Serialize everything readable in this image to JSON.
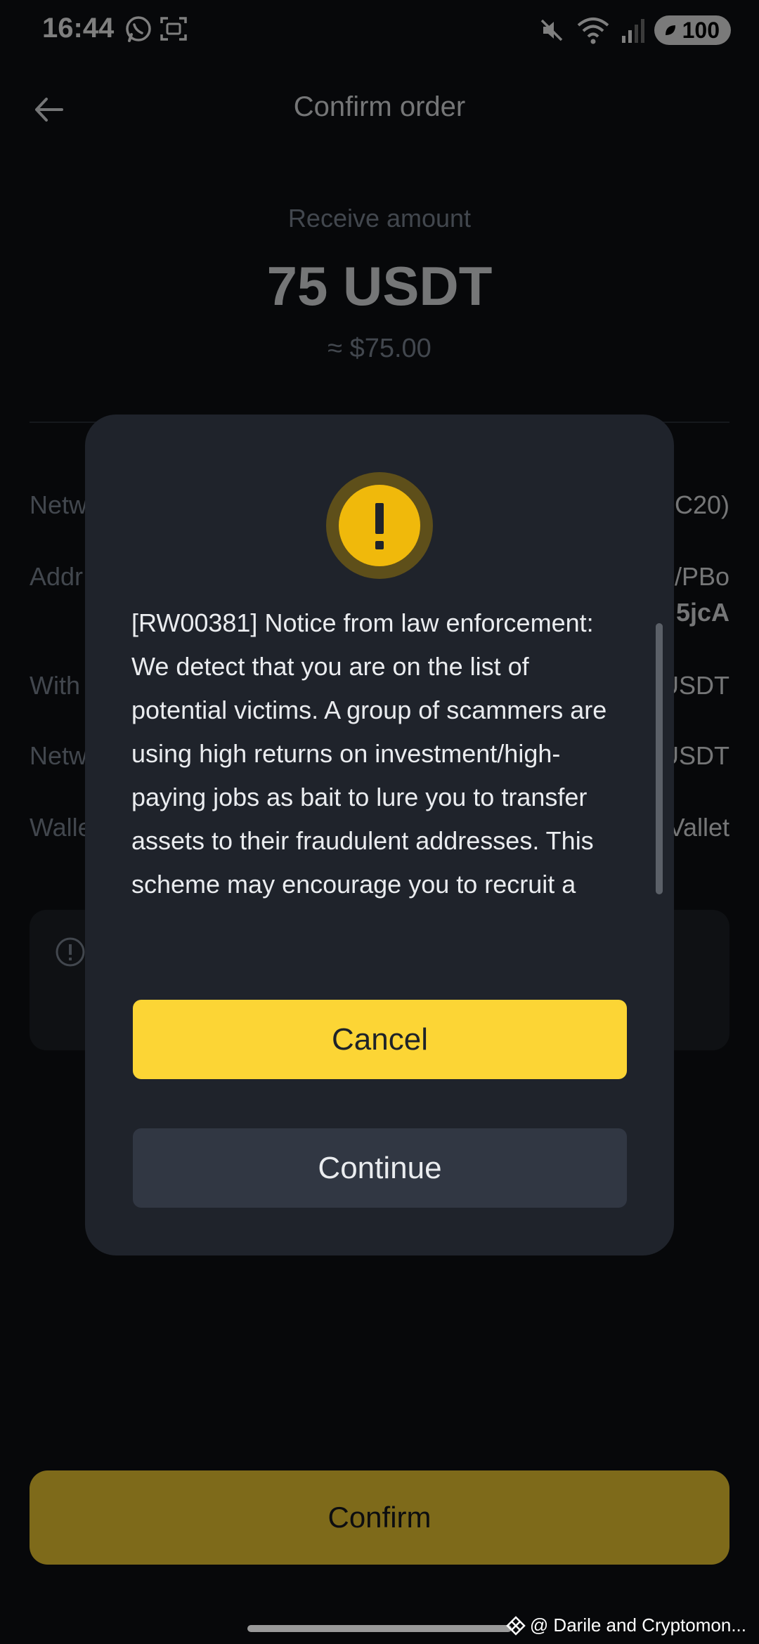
{
  "status_bar": {
    "time": "16:44",
    "app_icons": [
      "whatsapp-icon",
      "screenshot-icon"
    ],
    "right_icons": [
      "mute-icon",
      "wifi-icon",
      "signal-icon"
    ],
    "battery": "100"
  },
  "header": {
    "title": "Confirm order"
  },
  "receive": {
    "label": "Receive amount",
    "amount": "75 USDT",
    "fiat": "≈ $75.00"
  },
  "details": [
    {
      "label": "Netw",
      "value": "C20)"
    },
    {
      "label": "Addr",
      "value": "/PBo",
      "value2": "5jcA"
    },
    {
      "label": "With",
      "value": "USDT"
    },
    {
      "label": "Netw",
      "value": "USDT"
    },
    {
      "label": "Walle",
      "value": "Vallet"
    }
  ],
  "modal": {
    "icon": "warning-icon",
    "message": "[RW00381] Notice from law enforcement: We detect that you are on the list of potential victims. A group of scammers are using high returns on investment/high-paying jobs as bait to lure you to transfer assets to their fraudulent addresses. This scheme may encourage you to recruit a team of friends or elevate your VIP level to",
    "cancel_label": "Cancel",
    "continue_label": "Continue"
  },
  "footer": {
    "confirm_label": "Confirm"
  },
  "watermark": "@ Darile and Cryptomon...",
  "colors": {
    "accent": "#fcd535",
    "background": "#0f1114",
    "modal": "#1f232b"
  }
}
